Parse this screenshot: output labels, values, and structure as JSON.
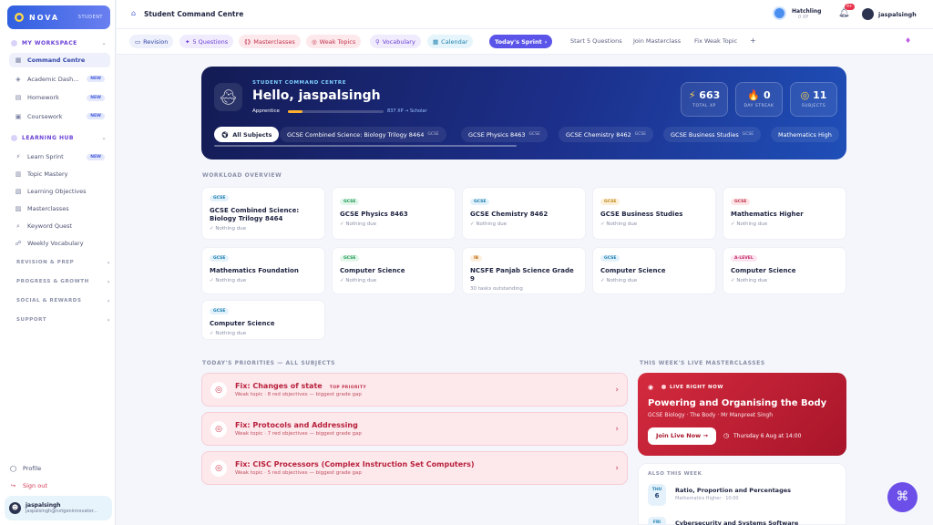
{
  "app": {
    "brand": "NOVA",
    "tag": "STUDENT"
  },
  "sidebar": {
    "workspace": "MY WORKSPACE",
    "ws": [
      {
        "l": "Command Centre",
        "n": ""
      },
      {
        "l": "Academic Dash...",
        "n": "NEW"
      },
      {
        "l": "Homework",
        "n": "NEW"
      },
      {
        "l": "Coursework",
        "n": "NEW"
      }
    ],
    "hub": "LEARNING HUB",
    "hb": [
      {
        "l": "Learn Sprint",
        "n": "NEW"
      },
      {
        "l": "Topic Mastery",
        "n": ""
      },
      {
        "l": "Learning Objectives",
        "n": ""
      },
      {
        "l": "Masterclasses",
        "n": ""
      },
      {
        "l": "Keyword Quest",
        "n": ""
      },
      {
        "l": "Weekly Vocabulary",
        "n": ""
      }
    ],
    "groups": [
      "REVISION & PREP",
      "PROGRESS & GROWTH",
      "SOCIAL & REWARDS",
      "SUPPORT"
    ],
    "profile": "Profile",
    "signout": "Sign out",
    "user": {
      "name": "jaspalsingh",
      "email": "jaspalsingh@nxtgeninnovator..."
    }
  },
  "top": {
    "title": "Student Command Centre",
    "level": "Hatchling",
    "xp": "0 XP",
    "notif": "9+",
    "user": "jaspalsingh"
  },
  "bar": {
    "pills": [
      "Revision",
      "5 Questions",
      "Masterclasses",
      "Weak Topics",
      "Vocabulary",
      "Calendar"
    ],
    "sprint": "Today's Sprint",
    "links": [
      "Start 5 Questions",
      "Join Masterclass",
      "Fix Weak Topic"
    ],
    "plus": "+"
  },
  "hero": {
    "kicker": "STUDENT COMMAND CENTRE",
    "greet": "Hello, jaspalsingh",
    "rank": "Apprentice",
    "xp": "837 XP → Scholar",
    "progress": 0.15,
    "stats": [
      {
        "v": "663",
        "l": "TOTAL XP",
        "i": "⚡"
      },
      {
        "v": "0",
        "l": "DAY STREAK",
        "i": "🔥"
      },
      {
        "v": "11",
        "l": "SUBJECTS",
        "i": "◎"
      }
    ],
    "tabs": [
      {
        "l": "All Subjects",
        "g": ""
      },
      {
        "l": "GCSE Combined Science: Biology Trilogy 8464",
        "g": "GCSE"
      },
      {
        "l": "GCSE Physics 8463",
        "g": "GCSE"
      },
      {
        "l": "GCSE Chemistry 8462",
        "g": "GCSE"
      },
      {
        "l": "GCSE Business Studies",
        "g": "GCSE"
      },
      {
        "l": "Mathematics High",
        "g": ""
      }
    ]
  },
  "workload": {
    "label": "WORKLOAD OVERVIEW",
    "cards": [
      {
        "b": "GCSE",
        "n": "GCSE Combined Science: Biology Trilogy 8464",
        "s": "✓ Nothing due"
      },
      {
        "b": "GCSE",
        "n": "GCSE Physics 8463",
        "s": "✓ Nothing due"
      },
      {
        "b": "GCSE",
        "n": "GCSE Chemistry 8462",
        "s": "✓ Nothing due"
      },
      {
        "b": "GCSE",
        "n": "GCSE Business Studies",
        "s": "✓ Nothing due"
      },
      {
        "b": "GCSE",
        "n": "Mathematics Higher",
        "s": "✓ Nothing due"
      },
      {
        "b": "GCSE",
        "n": "Mathematics Foundation",
        "s": "✓ Nothing due"
      },
      {
        "b": "GCSE",
        "n": "Computer Science",
        "s": "✓ Nothing due"
      },
      {
        "b": "IB",
        "n": "NCSFE Panjab Science Grade 9",
        "s": "30 tasks outstanding"
      },
      {
        "b": "GCSE",
        "n": "Computer Science",
        "s": "✓ Nothing due"
      },
      {
        "b": "A-LEVEL",
        "n": "Computer Science",
        "s": "✓ Nothing due"
      },
      {
        "b": "GCSE",
        "n": "Computer Science",
        "s": "✓ Nothing due"
      }
    ]
  },
  "priorities": {
    "label": "TODAY'S PRIORITIES — ALL SUBJECTS",
    "top": "TOP PRIORITY",
    "items": [
      {
        "t": "Fix: Changes of state",
        "s": "Weak topic · 8 red objectives — biggest grade gap"
      },
      {
        "t": "Fix: Protocols and Addressing",
        "s": "Weak topic · 7 red objectives — biggest grade gap"
      },
      {
        "t": "Fix: CISC Processors (Complex Instruction Set Computers)",
        "s": "Weak topic · 5 red objectives — biggest grade gap"
      }
    ]
  },
  "master": {
    "label": "THIS WEEK'S LIVE MASTERCLASSES",
    "live": "LIVE RIGHT NOW",
    "title": "Powering and Organising the Body",
    "sub": "GCSE Biology · The Body · Mr Manpreet Singh",
    "join": "Join Live Now →",
    "when": "Thursday 6 Aug at 14:00",
    "also": "ALSO THIS WEEK",
    "rows": [
      {
        "d": "THU",
        "n": "6",
        "t": "Ratio, Proportion and Percentages",
        "s": "Mathematics Higher · 10:00"
      },
      {
        "d": "FRI",
        "n": "",
        "t": "Cybersecurity and Systems Software",
        "s": ""
      }
    ]
  },
  "colors": {
    "accent": "#5b54e8",
    "live": "#d42a3e"
  }
}
